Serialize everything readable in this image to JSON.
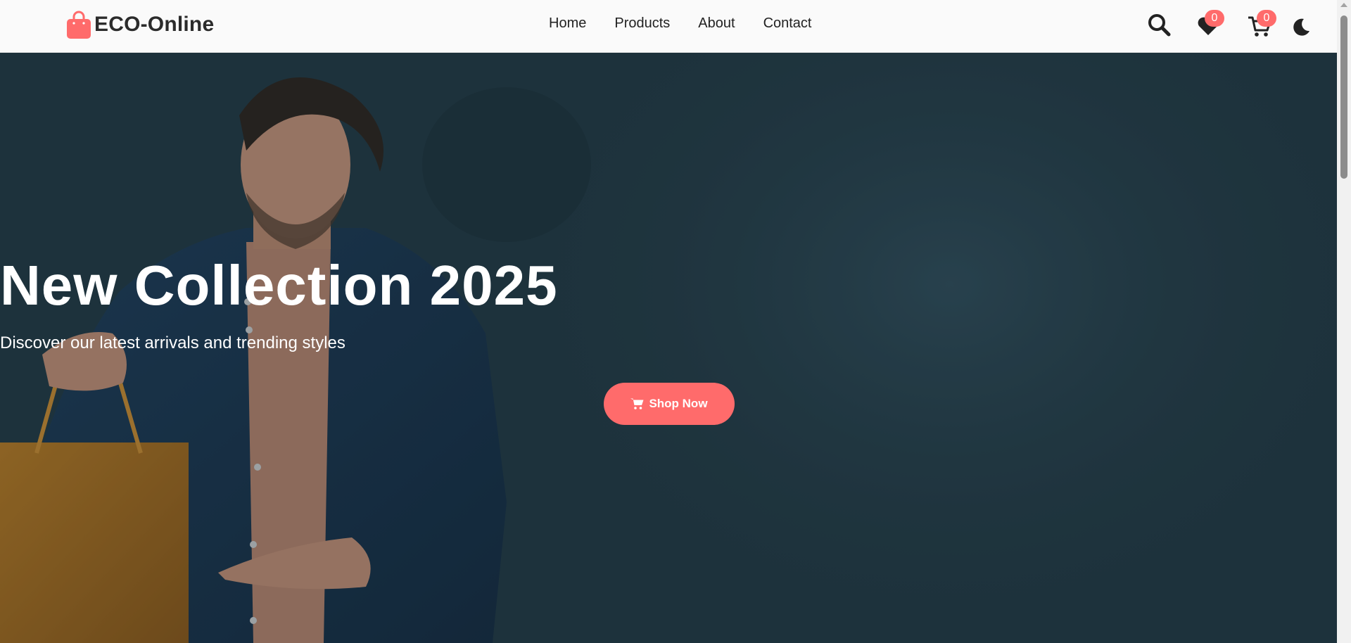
{
  "header": {
    "brand": {
      "name": "ECO-Online",
      "icon": "shopping-bag-icon",
      "icon_color": "#ff6b6b"
    },
    "nav": [
      {
        "label": "Home"
      },
      {
        "label": "Products"
      },
      {
        "label": "About"
      },
      {
        "label": "Contact"
      }
    ],
    "actions": {
      "search_icon": "search-icon",
      "wishlist": {
        "icon": "heart-icon",
        "count": "0"
      },
      "cart": {
        "icon": "cart-icon",
        "count": "0"
      },
      "theme_icon": "moon-icon"
    }
  },
  "hero": {
    "title": "New Collection 2025",
    "subtitle": "Discover our latest arrivals and trending styles",
    "cta": {
      "label": "Shop Now",
      "icon": "cart-icon"
    }
  },
  "colors": {
    "accent": "#ff6b6b",
    "nav_bg": "#fafafa",
    "hero_bg": "#21363f",
    "text_dark": "#222222"
  }
}
